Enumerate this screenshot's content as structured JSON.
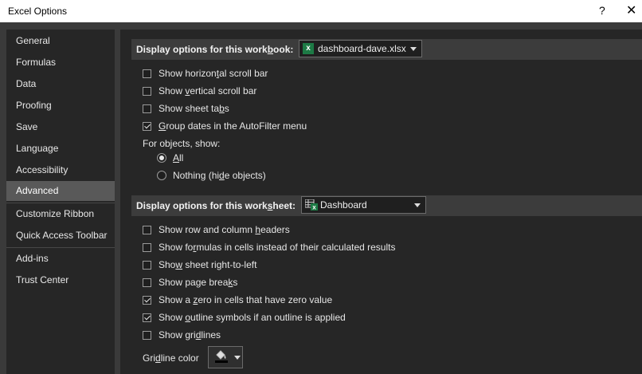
{
  "window": {
    "title": "Excel Options",
    "help_label": "?",
    "close_label": "✕"
  },
  "sidebar": {
    "items": [
      {
        "label": "General"
      },
      {
        "label": "Formulas"
      },
      {
        "label": "Data"
      },
      {
        "label": "Proofing"
      },
      {
        "label": "Save"
      },
      {
        "label": "Language"
      },
      {
        "label": "Accessibility"
      },
      {
        "label": "Advanced",
        "selected": true
      },
      {
        "label": "Customize Ribbon"
      },
      {
        "label": "Quick Access Toolbar"
      },
      {
        "label": "Add-ins"
      },
      {
        "label": "Trust Center"
      }
    ]
  },
  "workbook_section": {
    "label_pre": "Display options for this work",
    "label_key": "b",
    "label_post": "ook:",
    "dropdown_value": "dashboard-dave.xlsx",
    "file_icon": "excel-file-icon",
    "options": [
      {
        "pre": "Show horizon",
        "key": "t",
        "post": "al scroll bar",
        "checked": false
      },
      {
        "pre": "Show ",
        "key": "v",
        "post": "ertical scroll bar",
        "checked": false
      },
      {
        "pre": "Show sheet ta",
        "key": "b",
        "post": "s",
        "checked": false
      },
      {
        "pre": "",
        "key": "G",
        "post": "roup dates in the AutoFilter menu",
        "checked": true
      }
    ],
    "objects_label": "For objects, show:",
    "radios": [
      {
        "pre": "",
        "key": "A",
        "post": "ll",
        "selected": true
      },
      {
        "pre": "Nothing (hi",
        "key": "d",
        "post": "e objects)",
        "selected": false
      }
    ]
  },
  "worksheet_section": {
    "label_pre": "Display options for this work",
    "label_key": "s",
    "label_post": "heet:",
    "dropdown_value": "Dashboard",
    "sheet_icon": "worksheet-icon",
    "options": [
      {
        "pre": "Show row and column ",
        "key": "h",
        "post": "eaders",
        "checked": false
      },
      {
        "pre": "Show fo",
        "key": "r",
        "post": "mulas in cells instead of their calculated results",
        "checked": false
      },
      {
        "pre": "Sho",
        "key": "w",
        "post": " sheet right-to-left",
        "checked": false
      },
      {
        "pre": "Show page brea",
        "key": "k",
        "post": "s",
        "checked": false
      },
      {
        "pre": "Show a ",
        "key": "z",
        "post": "ero in cells that have zero value",
        "checked": true
      },
      {
        "pre": "Show ",
        "key": "o",
        "post": "utline symbols if an outline is applied",
        "checked": true
      },
      {
        "pre": "Show gri",
        "key": "d",
        "post": "lines",
        "checked": false
      }
    ],
    "gridline_color_pre": "Gri",
    "gridline_color_key": "d",
    "gridline_color_post": "line color",
    "gridline_swatch": "#000000",
    "fill_icon": "paint-bucket-icon"
  },
  "colors": {
    "background": "#262626",
    "selected_nav": "#595959",
    "section_header": "#3c3c3c",
    "excel_green": "#1d7a45"
  }
}
